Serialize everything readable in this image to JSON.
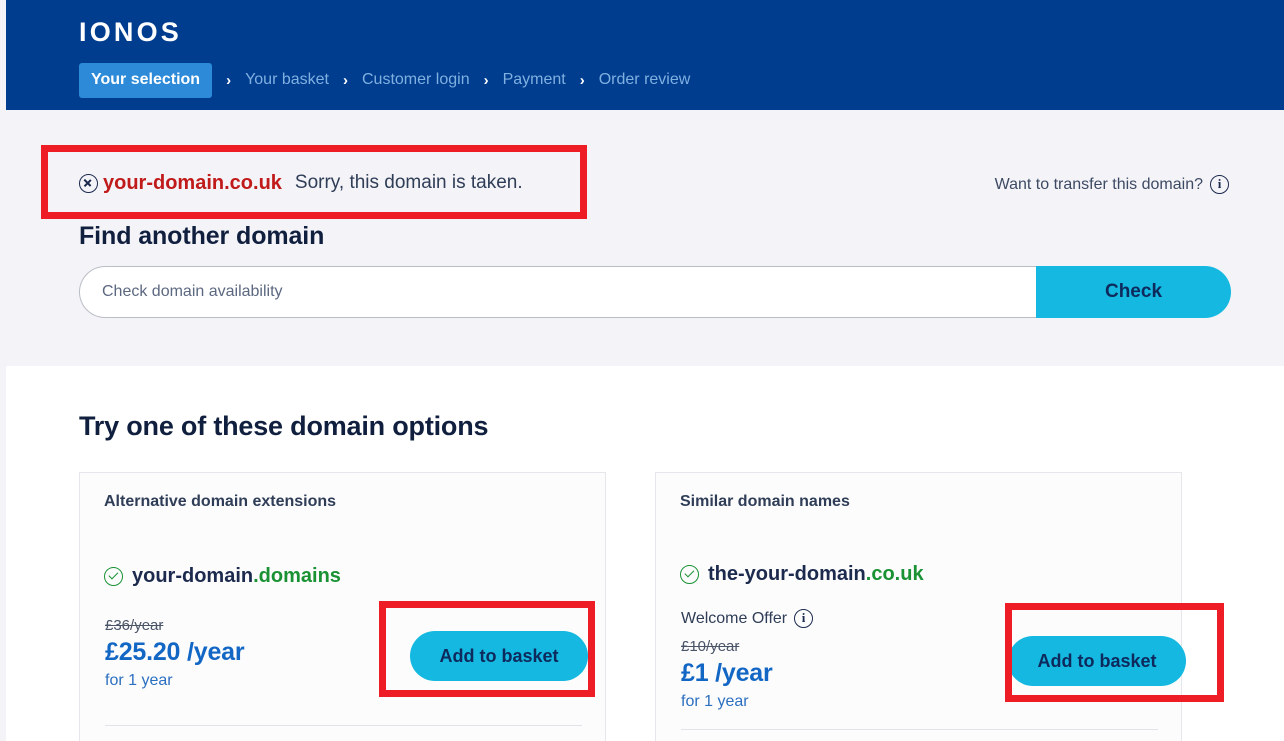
{
  "brand": {
    "logo": "IONOS",
    "accent_cyan": "#14b8e0",
    "header_blue": "#003d8f",
    "error_red": "#c01a1a",
    "annotation_red": "#ee1c25",
    "link_blue": "#1266c4",
    "success_green": "#1a9234"
  },
  "breadcrumb": {
    "separator": "›",
    "steps": [
      {
        "label": "Your selection",
        "active": true
      },
      {
        "label": "Your basket",
        "active": false
      },
      {
        "label": "Customer login",
        "active": false
      },
      {
        "label": "Payment",
        "active": false
      },
      {
        "label": "Order review",
        "active": false
      }
    ]
  },
  "result": {
    "icon": "error-circle-x-icon",
    "domain": "your-domain.co.uk",
    "message": "Sorry, this domain is taken."
  },
  "transfer": {
    "text": "Want to transfer this domain?",
    "icon": "info-icon"
  },
  "search": {
    "heading": "Find another domain",
    "placeholder": "Check domain availability",
    "value": "",
    "button_label": "Check"
  },
  "options": {
    "heading": "Try one of these domain options",
    "cards": [
      {
        "title": "Alternative domain extensions",
        "domain_name": "your-domain",
        "domain_tld": ".domains",
        "status_icon": "check-circle-icon",
        "offer_label": "",
        "price_old": "£36/year",
        "price_new": "£25.20 /year",
        "price_term": "for 1 year",
        "button_label": "Add to basket"
      },
      {
        "title": "Similar domain names",
        "domain_name": "the-your-domain",
        "domain_tld": ".co.uk",
        "status_icon": "check-circle-icon",
        "offer_label": "Welcome Offer",
        "offer_icon": "info-icon",
        "price_old": "£10/year",
        "price_new": "£1 /year",
        "price_term": "for 1 year",
        "button_label": "Add to basket"
      }
    ]
  }
}
